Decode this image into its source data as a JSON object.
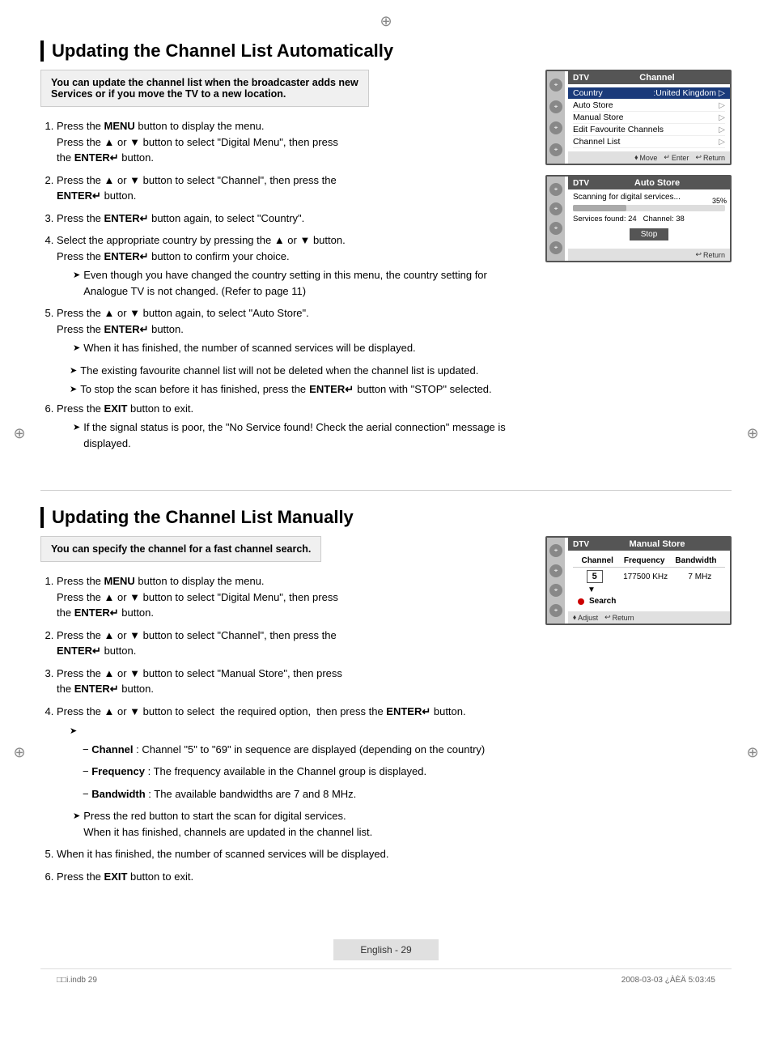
{
  "section1": {
    "title": "Updating the Channel List Automatically",
    "intro": "You can update the channel list when the broadcaster adds new\nServices or if you move the TV to a new location.",
    "steps": [
      {
        "id": 1,
        "text": "Press the MENU button to display the menu.\nPress the ▲ or ▼ button to select \"Digital Menu\", then press\nthe ENTER↵ button."
      },
      {
        "id": 2,
        "text": "Press the ▲ or ▼ button to select \"Channel\", then press the\nENTER↵ button."
      },
      {
        "id": 3,
        "text": "Press the ENTER↵ button again, to select \"Country\"."
      },
      {
        "id": 4,
        "text": "Select the appropriate country by pressing the ▲ or ▼ button.\nPress the ENTER↵ button to confirm your choice.",
        "note": "Even though you have changed the country setting in this menu, the country setting for Analogue TV is not changed. (Refer to page 11)"
      },
      {
        "id": 5,
        "text": "Press the ▲ or ▼ button again, to select \"Auto Store\".\nPress the ENTER↵ button.",
        "notes": [
          "When it has finished, the number of scanned services will be displayed.",
          "The existing favourite channel list will not be deleted when the channel list is updated.",
          "To stop the scan before it has finished, press the ENTER↵ button with \"STOP\" selected."
        ]
      },
      {
        "id": 6,
        "text": "Press the EXIT button to exit.",
        "note": "If the signal status is poor, the \"No Service found! Check the aerial connection\" message is displayed."
      }
    ],
    "screen1": {
      "dtv": "DTV",
      "title": "Channel",
      "items": [
        {
          "label": "Country",
          "value": ":United Kingdom",
          "highlight": true
        },
        {
          "label": "Auto Store",
          "value": "",
          "arrow": true
        },
        {
          "label": "Manual Store",
          "value": "",
          "arrow": true
        },
        {
          "label": "Edit Favourite Channels",
          "value": "",
          "arrow": true
        },
        {
          "label": "Channel List",
          "value": "",
          "arrow": true
        }
      ],
      "footer": [
        "Move",
        "Enter",
        "Return"
      ]
    },
    "screen2": {
      "dtv": "DTV",
      "title": "Auto Store",
      "scanning": "Scanning for digital services...",
      "progress": 35,
      "progressLabel": "35%",
      "services": "Services found: 24",
      "channel": "Channel: 38",
      "stopBtn": "Stop",
      "footer": "Return"
    }
  },
  "section2": {
    "title": "Updating the Channel List Manually",
    "intro": "You can specify the channel for a fast channel search.",
    "steps": [
      {
        "id": 1,
        "text": "Press the MENU button to display the menu.\nPress the ▲ or ▼ button to select \"Digital Menu\", then press\nthe ENTER↵ button."
      },
      {
        "id": 2,
        "text": "Press the ▲ or ▼ button to select \"Channel\", then press the\nENTER↵ button."
      },
      {
        "id": 3,
        "text": "Press the ▲ or ▼ button to select \"Manual Store\", then press\nthe ENTER↵ button."
      },
      {
        "id": 4,
        "text": "Press the ▲ or ▼ button to select  the required option,  then press the ENTER↵ button.",
        "subitems": [
          "Channel : Channel \"5\" to \"69\" in sequence are displayed (depending on the country)",
          "Frequency : The frequency available in the Channel group is displayed.",
          "Bandwidth : The available bandwidths are 7 and 8 MHz.",
          "Press the red button to start the scan for digital services.\nWhen it has finished, channels are updated in the channel list."
        ]
      },
      {
        "id": 5,
        "text": "When it has finished, the number of scanned services will be displayed."
      },
      {
        "id": 6,
        "text": "Press the EXIT button to exit."
      }
    ],
    "screen3": {
      "dtv": "DTV",
      "title": "Manual Store",
      "cols": [
        "Channel",
        "Frequency",
        "Bandwidth"
      ],
      "channelVal": "5",
      "freqVal": "177500",
      "freqUnit": "KHz",
      "bwVal": "7",
      "bwUnit": "MHz",
      "searchLabel": "Search",
      "footer": [
        "Adjust",
        "Return"
      ]
    }
  },
  "pageFooter": {
    "label": "English - 29"
  },
  "printFooter": {
    "left": "□□i.indb  29",
    "right": "2008-03-03   ¿ÀÈÄ 5:03:45"
  }
}
